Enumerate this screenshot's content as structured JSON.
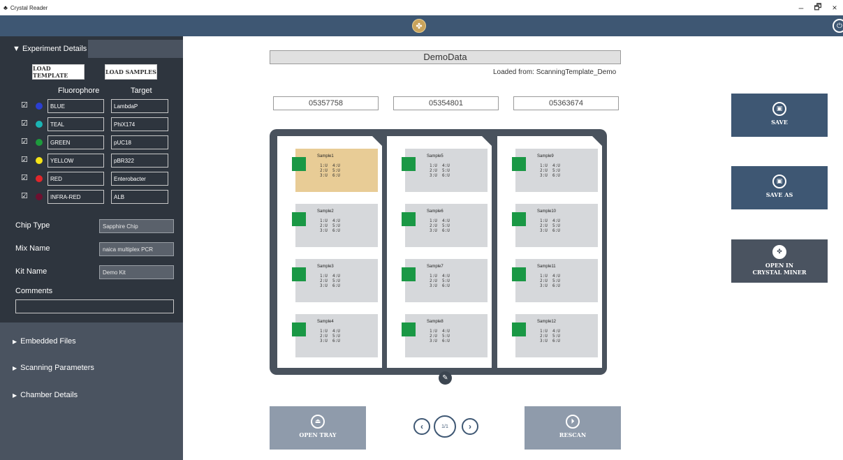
{
  "window": {
    "title": "Crystal Reader",
    "app_icon": "crystal-icon",
    "minimize": "–",
    "maximize": "🗗",
    "close": "×"
  },
  "topbar": {
    "logo_icon": "crystal-logo-icon",
    "power_icon": "power-icon"
  },
  "sidebar": {
    "experiment_tab": "▼ Experiment Details",
    "load_template": "LOAD TEMPLATE",
    "load_samples": "LOAD SAMPLES",
    "fluorophore_header": "Fluorophore",
    "target_header": "Target",
    "fluorophores": [
      {
        "checked": "☑",
        "name": "BLUE",
        "target": "LambdaP",
        "color": "#2b3fd1"
      },
      {
        "checked": "☑",
        "name": "TEAL",
        "target": "PhiX174",
        "color": "#1bb4b4"
      },
      {
        "checked": "☑",
        "name": "GREEN",
        "target": "pUC18",
        "color": "#1d9a3c"
      },
      {
        "checked": "☑",
        "name": "YELLOW",
        "target": "pBR322",
        "color": "#f5e318"
      },
      {
        "checked": "☑",
        "name": "RED",
        "target": "Enterobacter",
        "color": "#e0262b"
      },
      {
        "checked": "☑",
        "name": "INFRA-RED",
        "target": "ALB",
        "color": "#6e1030"
      }
    ],
    "chip_type_label": "Chip Type",
    "chip_type_value": "Sapphire Chip",
    "mix_name_label": "Mix Name",
    "mix_name_value": "naica multiplex PCR",
    "kit_name_label": "Kit Name",
    "kit_name_value": "Demo Kit",
    "comments_label": "Comments",
    "comments_value": "",
    "sections": [
      "Embedded Files",
      "Scanning Parameters",
      "Chamber Details"
    ]
  },
  "main": {
    "title": "DemoData",
    "loaded_from": "Loaded from: ScanningTemplate_Demo",
    "chip_ids": [
      "05357758",
      "05354801",
      "05363674"
    ],
    "samples": [
      [
        "Sample1",
        "Sample2",
        "Sample3",
        "Sample4"
      ],
      [
        "Sample5",
        "Sample6",
        "Sample7",
        "Sample8"
      ],
      [
        "Sample9",
        "Sample10",
        "Sample11",
        "Sample12"
      ]
    ],
    "chamber_cells": "1:U  4:U\n2:U  5:U\n3:U  6:U",
    "selected_sample": "Sample1",
    "open_tray": "OPEN TRAY",
    "rescan": "RESCAN",
    "page_indicator": "1/1",
    "prev_icon": "‹",
    "next_icon": "›"
  },
  "actions": {
    "save": "SAVE",
    "save_as": "SAVE AS",
    "open_in_line1": "OPEN IN",
    "open_in_line2": "CRYSTAL MINER"
  },
  "colors": {
    "accent": "#3e5773",
    "sidebar": "#2e353e",
    "chamber_green": "#1a9845",
    "selected": "#e8cc96"
  }
}
